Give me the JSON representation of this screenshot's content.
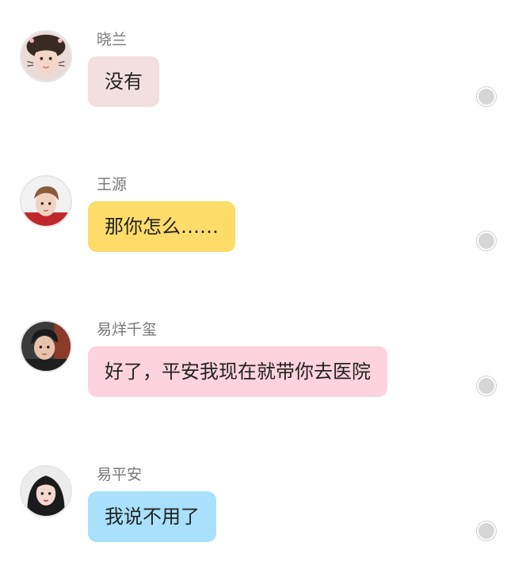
{
  "messages": [
    {
      "sender": "晓兰",
      "text": "没有",
      "bubble_color": "#f2dfdf",
      "avatar": "girl-face-avatar"
    },
    {
      "sender": "王源",
      "text": "那你怎么……",
      "bubble_color": "#fddc6a",
      "avatar": "young-man-avatar"
    },
    {
      "sender": "易烊千玺",
      "text": "好了，平安我现在就带你去医院",
      "bubble_color": "#fdd3df",
      "avatar": "young-man-cap-avatar"
    },
    {
      "sender": "易平安",
      "text": "我说不用了",
      "bubble_color": "#a9e0fb",
      "avatar": "dark-hair-girl-avatar"
    }
  ],
  "colors": {
    "name_text": "#777777",
    "bubble_text": "#222222",
    "status_dot": "#d6d6d6",
    "background": "#ffffff"
  }
}
